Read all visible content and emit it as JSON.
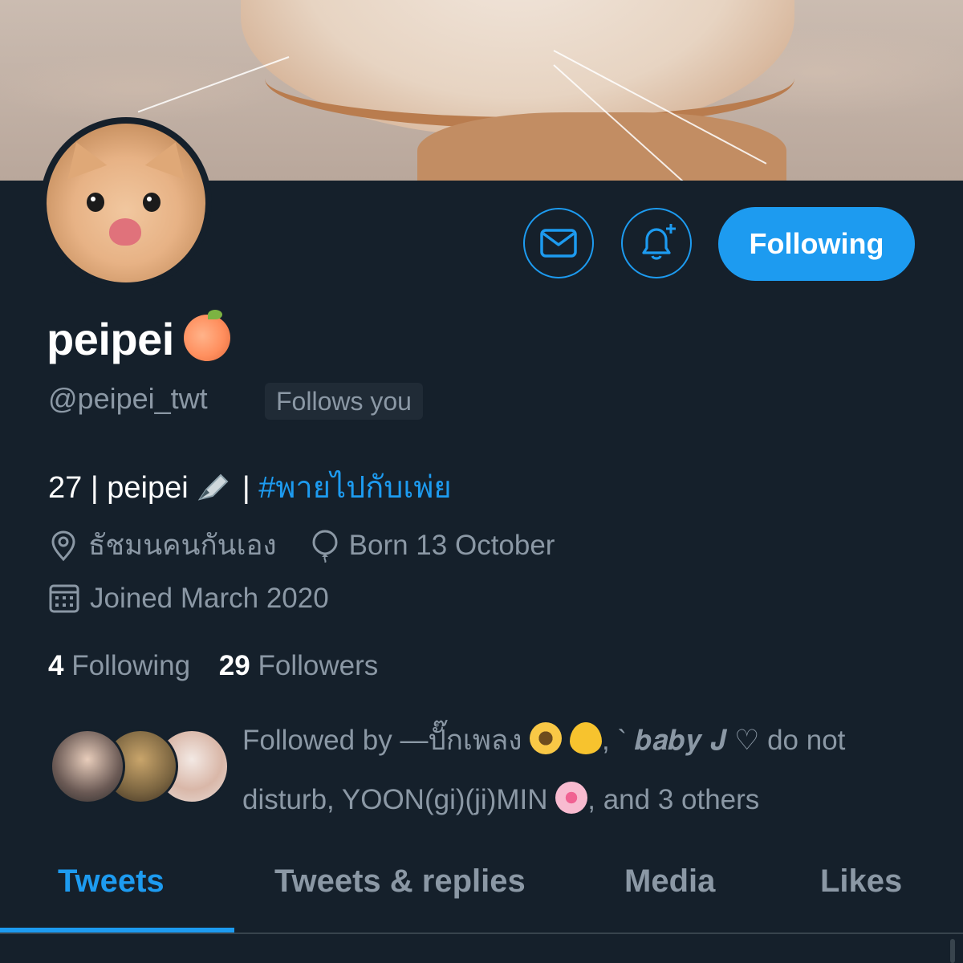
{
  "profile": {
    "display_name": "peipei",
    "handle": "@peipei_twt",
    "follows_you_label": "Follows you",
    "bio_prefix": "27 | peipei",
    "bio_separator": "|",
    "bio_hashtag": "#พายไปกับเพ่ย",
    "location": "ธัชมนคนกันเอง",
    "birthday": "Born 13 October",
    "joined": "Joined March 2020"
  },
  "actions": {
    "following_button_label": "Following"
  },
  "stats": {
    "following_count": "4",
    "following_label": "Following",
    "followers_count": "29",
    "followers_label": "Followers"
  },
  "followed_by": {
    "prefix": "Followed by —ปั๊กเพลง",
    "name2": ", ` 𝒃𝒂𝒃𝒚 𝑱 ♡ do not disturb,",
    "name3": "YOON(gi)(ji)MIN",
    "suffix": ", and 3 others"
  },
  "tabs": [
    {
      "label": "Tweets",
      "active": true
    },
    {
      "label": "Tweets & replies",
      "active": false
    },
    {
      "label": "Media",
      "active": false
    },
    {
      "label": "Likes",
      "active": false
    }
  ],
  "icons": {
    "message": "envelope-icon",
    "notify": "bell-plus-icon",
    "location": "location-pin-icon",
    "birthday": "balloon-icon",
    "joined": "calendar-icon"
  },
  "colors": {
    "background": "#15202b",
    "accent": "#1d9bf0",
    "secondary_text": "#8b98a5",
    "badge_bg": "#202b36"
  }
}
